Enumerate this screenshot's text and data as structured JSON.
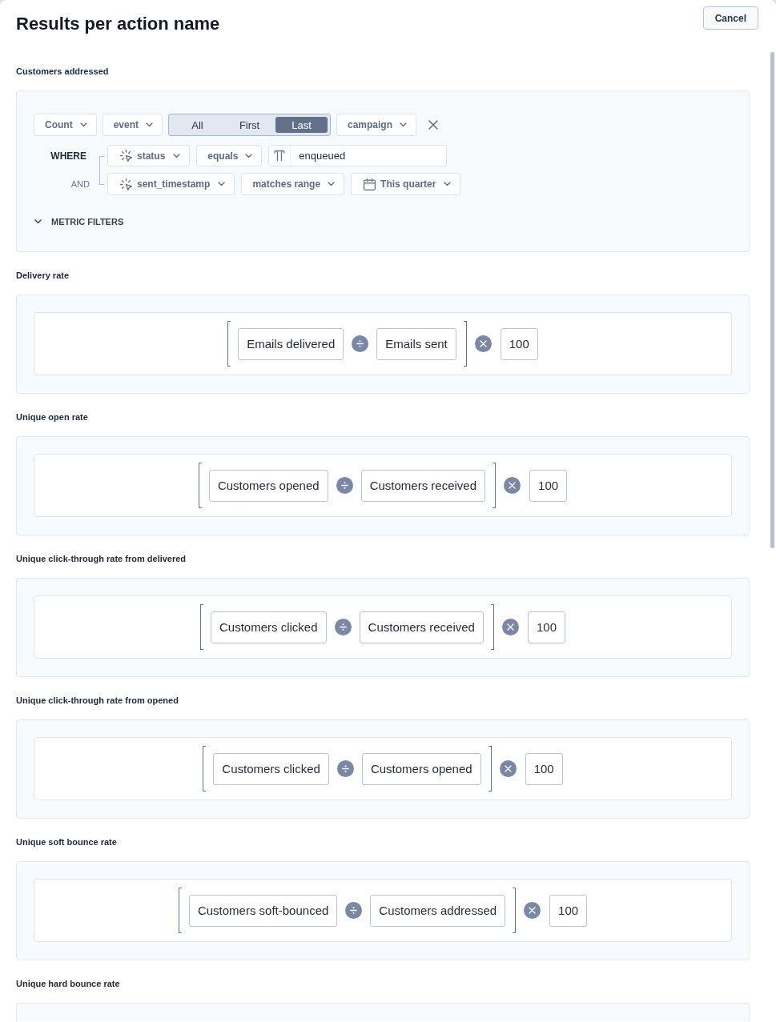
{
  "dialog": {
    "title": "Results per action name",
    "cancel_button": "Cancel"
  },
  "sections": [
    {
      "label": "Customers addressed",
      "kind": "query",
      "query": {
        "aggregate": "Count",
        "source": "event",
        "segments": [
          {
            "label": "All",
            "selected": false
          },
          {
            "label": "First",
            "selected": false
          },
          {
            "label": "Last",
            "selected": true
          }
        ],
        "attribute": "campaign",
        "conditions": [
          {
            "connector": "WHERE",
            "field": "status",
            "operator": "equals",
            "value": {
              "kind": "text",
              "text": "enqueued"
            }
          },
          {
            "connector": "AND",
            "field": "sent_timestamp",
            "operator": "matches range",
            "value": {
              "kind": "date",
              "text": "This quarter"
            }
          }
        ],
        "metric_filters": {
          "label": "METRIC FILTERS",
          "expanded": false
        }
      }
    },
    {
      "label": "Delivery rate",
      "kind": "formula",
      "formula": {
        "numerator": "Emails delivered",
        "denominator": "Emails sent",
        "multiplier": "100"
      }
    },
    {
      "label": "Unique open rate",
      "kind": "formula",
      "formula": {
        "numerator": "Customers opened",
        "denominator": "Customers received",
        "multiplier": "100"
      }
    },
    {
      "label": "Unique click-through rate from delivered",
      "kind": "formula",
      "formula": {
        "numerator": "Customers clicked",
        "denominator": "Customers received",
        "multiplier": "100"
      }
    },
    {
      "label": "Unique click-through rate from opened",
      "kind": "formula",
      "formula": {
        "numerator": "Customers clicked",
        "denominator": "Customers opened",
        "multiplier": "100"
      }
    },
    {
      "label": "Unique soft bounce rate",
      "kind": "formula",
      "formula": {
        "numerator": "Customers soft-bounced",
        "denominator": "Customers addressed",
        "multiplier": "100"
      }
    },
    {
      "label": "Unique hard bounce rate",
      "kind": "formula"
    }
  ]
}
